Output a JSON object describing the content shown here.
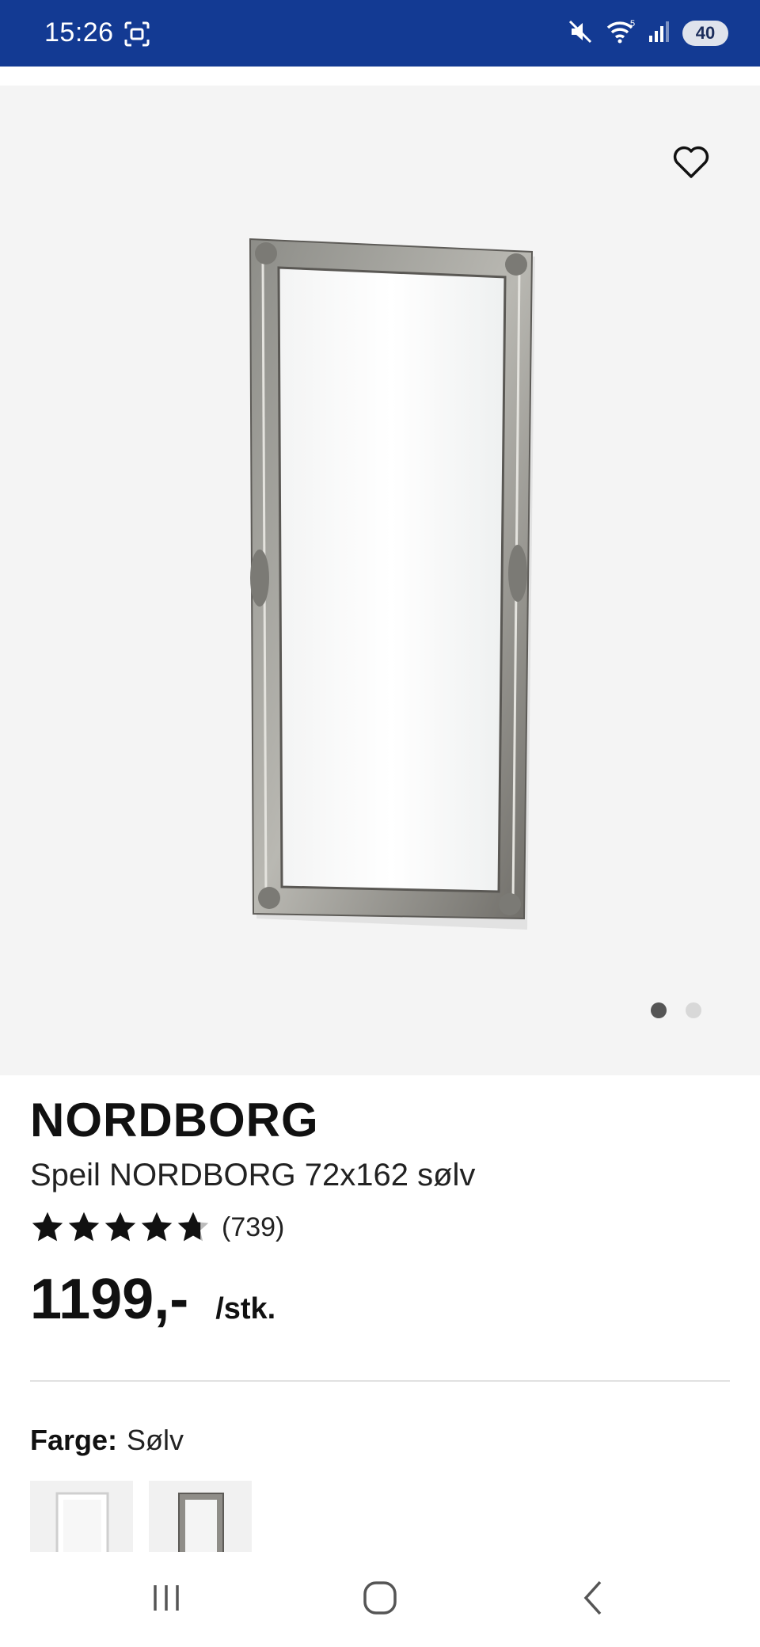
{
  "status_bar": {
    "time": "15:26",
    "battery": "40",
    "icons": [
      "screen-record-icon",
      "mute-icon",
      "wifi-icon",
      "signal-icon",
      "battery-icon"
    ]
  },
  "product": {
    "brand": "NORDBORG",
    "name": "Speil NORDBORG 72x162 sølv",
    "rating": 4.7,
    "rating_max": 5,
    "review_count": "(739)",
    "price": "1199,-",
    "unit": "/stk."
  },
  "gallery": {
    "image_count": 2,
    "active_index": 0
  },
  "color": {
    "label": "Farge:",
    "value": "Sølv"
  },
  "colors": {
    "status_bar": "#133a93",
    "gallery_bg": "#f4f4f4",
    "text": "#111111"
  }
}
